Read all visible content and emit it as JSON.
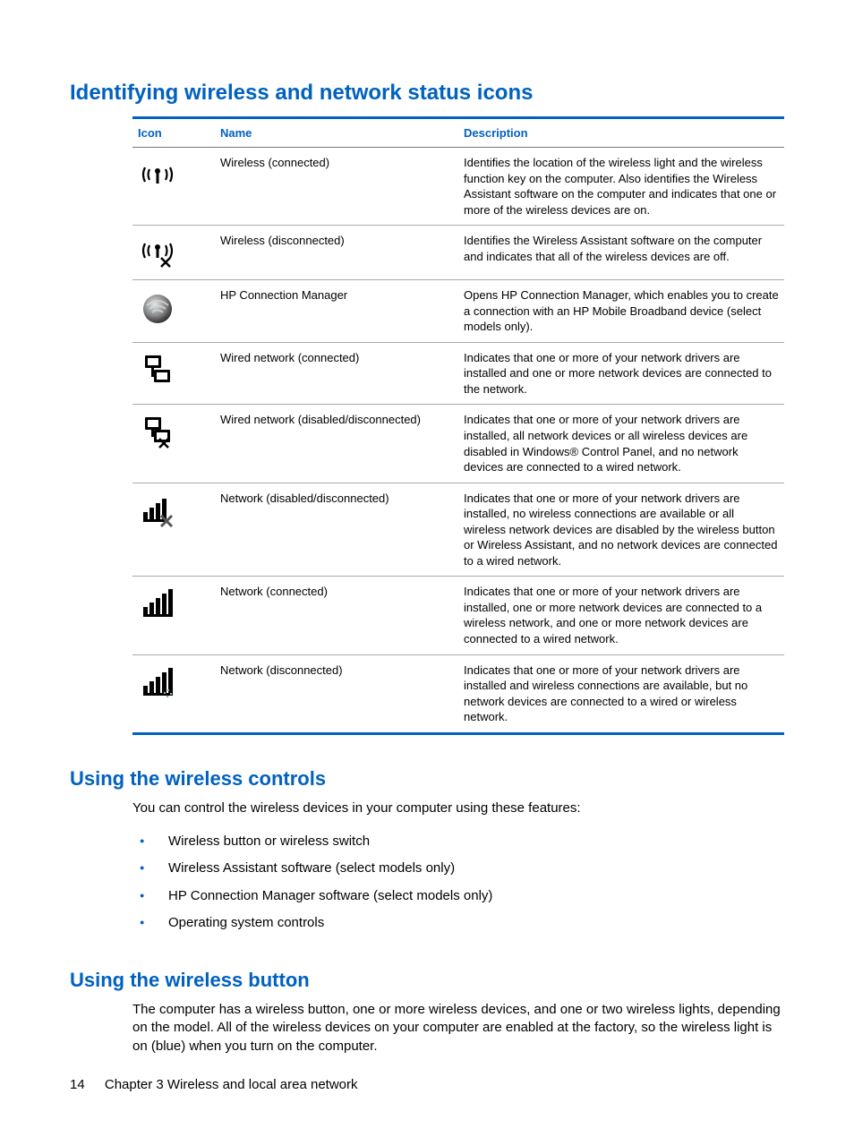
{
  "headings": {
    "identifying": "Identifying wireless and network status icons",
    "using_controls": "Using the wireless controls",
    "using_button": "Using the wireless button"
  },
  "table": {
    "header_icon": "Icon",
    "header_name": "Name",
    "header_desc": "Description",
    "rows": [
      {
        "name": "Wireless (connected)",
        "desc": "Identifies the location of the wireless light and the wireless function key on the computer. Also identifies the Wireless Assistant software on the computer and indicates that one or more of the wireless devices are on."
      },
      {
        "name": "Wireless (disconnected)",
        "desc": "Identifies the Wireless Assistant software on the computer and indicates that all of the wireless devices are off."
      },
      {
        "name": "HP Connection Manager",
        "desc": "Opens HP Connection Manager, which enables you to create a connection with an HP Mobile Broadband device (select models only)."
      },
      {
        "name": "Wired network (connected)",
        "desc": "Indicates that one or more of your network drivers are installed and one or more network devices are connected to the network."
      },
      {
        "name": "Wired network (disabled/disconnected)",
        "desc": "Indicates that one or more of your network drivers are installed, all network devices or all wireless devices are disabled in Windows® Control Panel, and no network devices are connected to a wired network."
      },
      {
        "name": "Network (disabled/disconnected)",
        "desc": "Indicates that one or more of your network drivers are installed, no wireless connections are available or all wireless network devices are disabled by the wireless button or Wireless Assistant, and no network devices are connected to a wired network."
      },
      {
        "name": "Network (connected)",
        "desc": "Indicates that one or more of your network drivers are installed, one or more network devices are connected to a wireless network, and one or more network devices are connected to a wired network."
      },
      {
        "name": "Network (disconnected)",
        "desc": "Indicates that one or more of your network drivers are installed and wireless connections are available, but no network devices are connected to a wired or wireless network."
      }
    ]
  },
  "controls_intro": "You can control the wireless devices in your computer using these features:",
  "controls_list": [
    "Wireless button or wireless switch",
    "Wireless Assistant software (select models only)",
    "HP Connection Manager software (select models only)",
    "Operating system controls"
  ],
  "button_para": "The computer has a wireless button, one or more wireless devices, and one or two wireless lights, depending on the model. All of the wireless devices on your computer are enabled at the factory, so the wireless light is on (blue) when you turn on the computer.",
  "footer": {
    "page_num": "14",
    "chapter": "Chapter 3   Wireless and local area network"
  }
}
